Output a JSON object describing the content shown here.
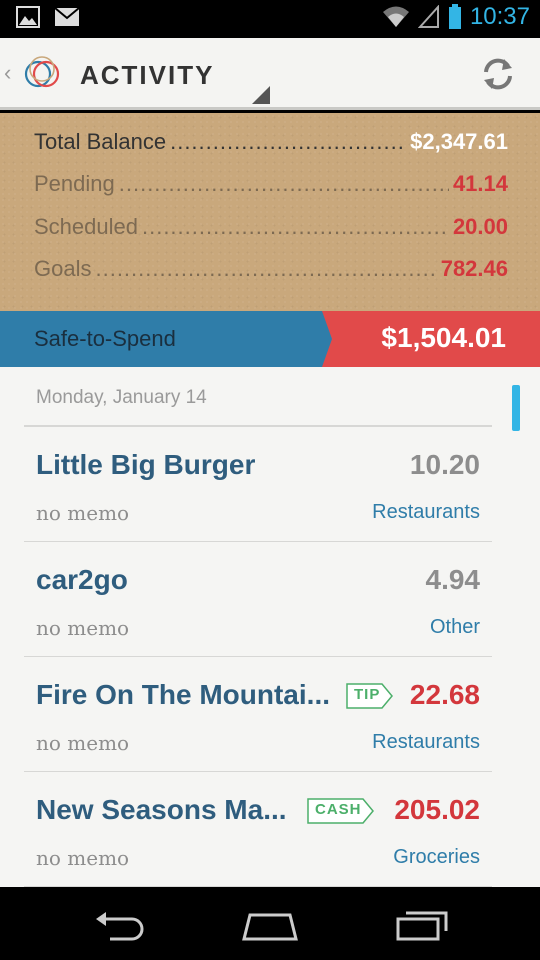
{
  "status_bar": {
    "time": "10:37",
    "icons": [
      "image-icon",
      "gmail-icon",
      "wifi-icon",
      "signal-icon",
      "battery-icon"
    ],
    "time_color": "#33b5e5"
  },
  "action_bar": {
    "title": "ACTIVITY",
    "back_icon": "chevron-left-icon",
    "logo_icon": "app-logo-icon",
    "refresh_icon": "refresh-icon"
  },
  "balance": {
    "total_label": "Total Balance",
    "total_value": "$2,347.61",
    "pending_label": "Pending",
    "pending_value": "41.14",
    "scheduled_label": "Scheduled",
    "scheduled_value": "20.00",
    "goals_label": "Goals",
    "goals_value": "782.46"
  },
  "safe_to_spend": {
    "label": "Safe-to-Spend",
    "value": "$1,504.01"
  },
  "date_header": "Monday, January 14",
  "transactions": [
    {
      "name": "Little Big Burger",
      "amount": "10.20",
      "memo": "no memo",
      "category": "Restaurants",
      "tag": ""
    },
    {
      "name": "car2go",
      "amount": "4.94",
      "memo": "no memo",
      "category": "Other",
      "tag": ""
    },
    {
      "name": "Fire On The Mountai...",
      "amount": "22.68",
      "memo": "no memo",
      "category": "Restaurants",
      "tag": "TIP"
    },
    {
      "name": "New Seasons Ma...",
      "amount": "205.02",
      "memo": "no memo",
      "category": "Groceries",
      "tag": "CASH"
    }
  ],
  "colors": {
    "accent_blue": "#2f7da9",
    "accent_red": "#e14a4a",
    "tag_green": "#4caf6a"
  },
  "nav": {
    "back": "back-icon",
    "home": "home-icon",
    "recents": "recents-icon"
  }
}
